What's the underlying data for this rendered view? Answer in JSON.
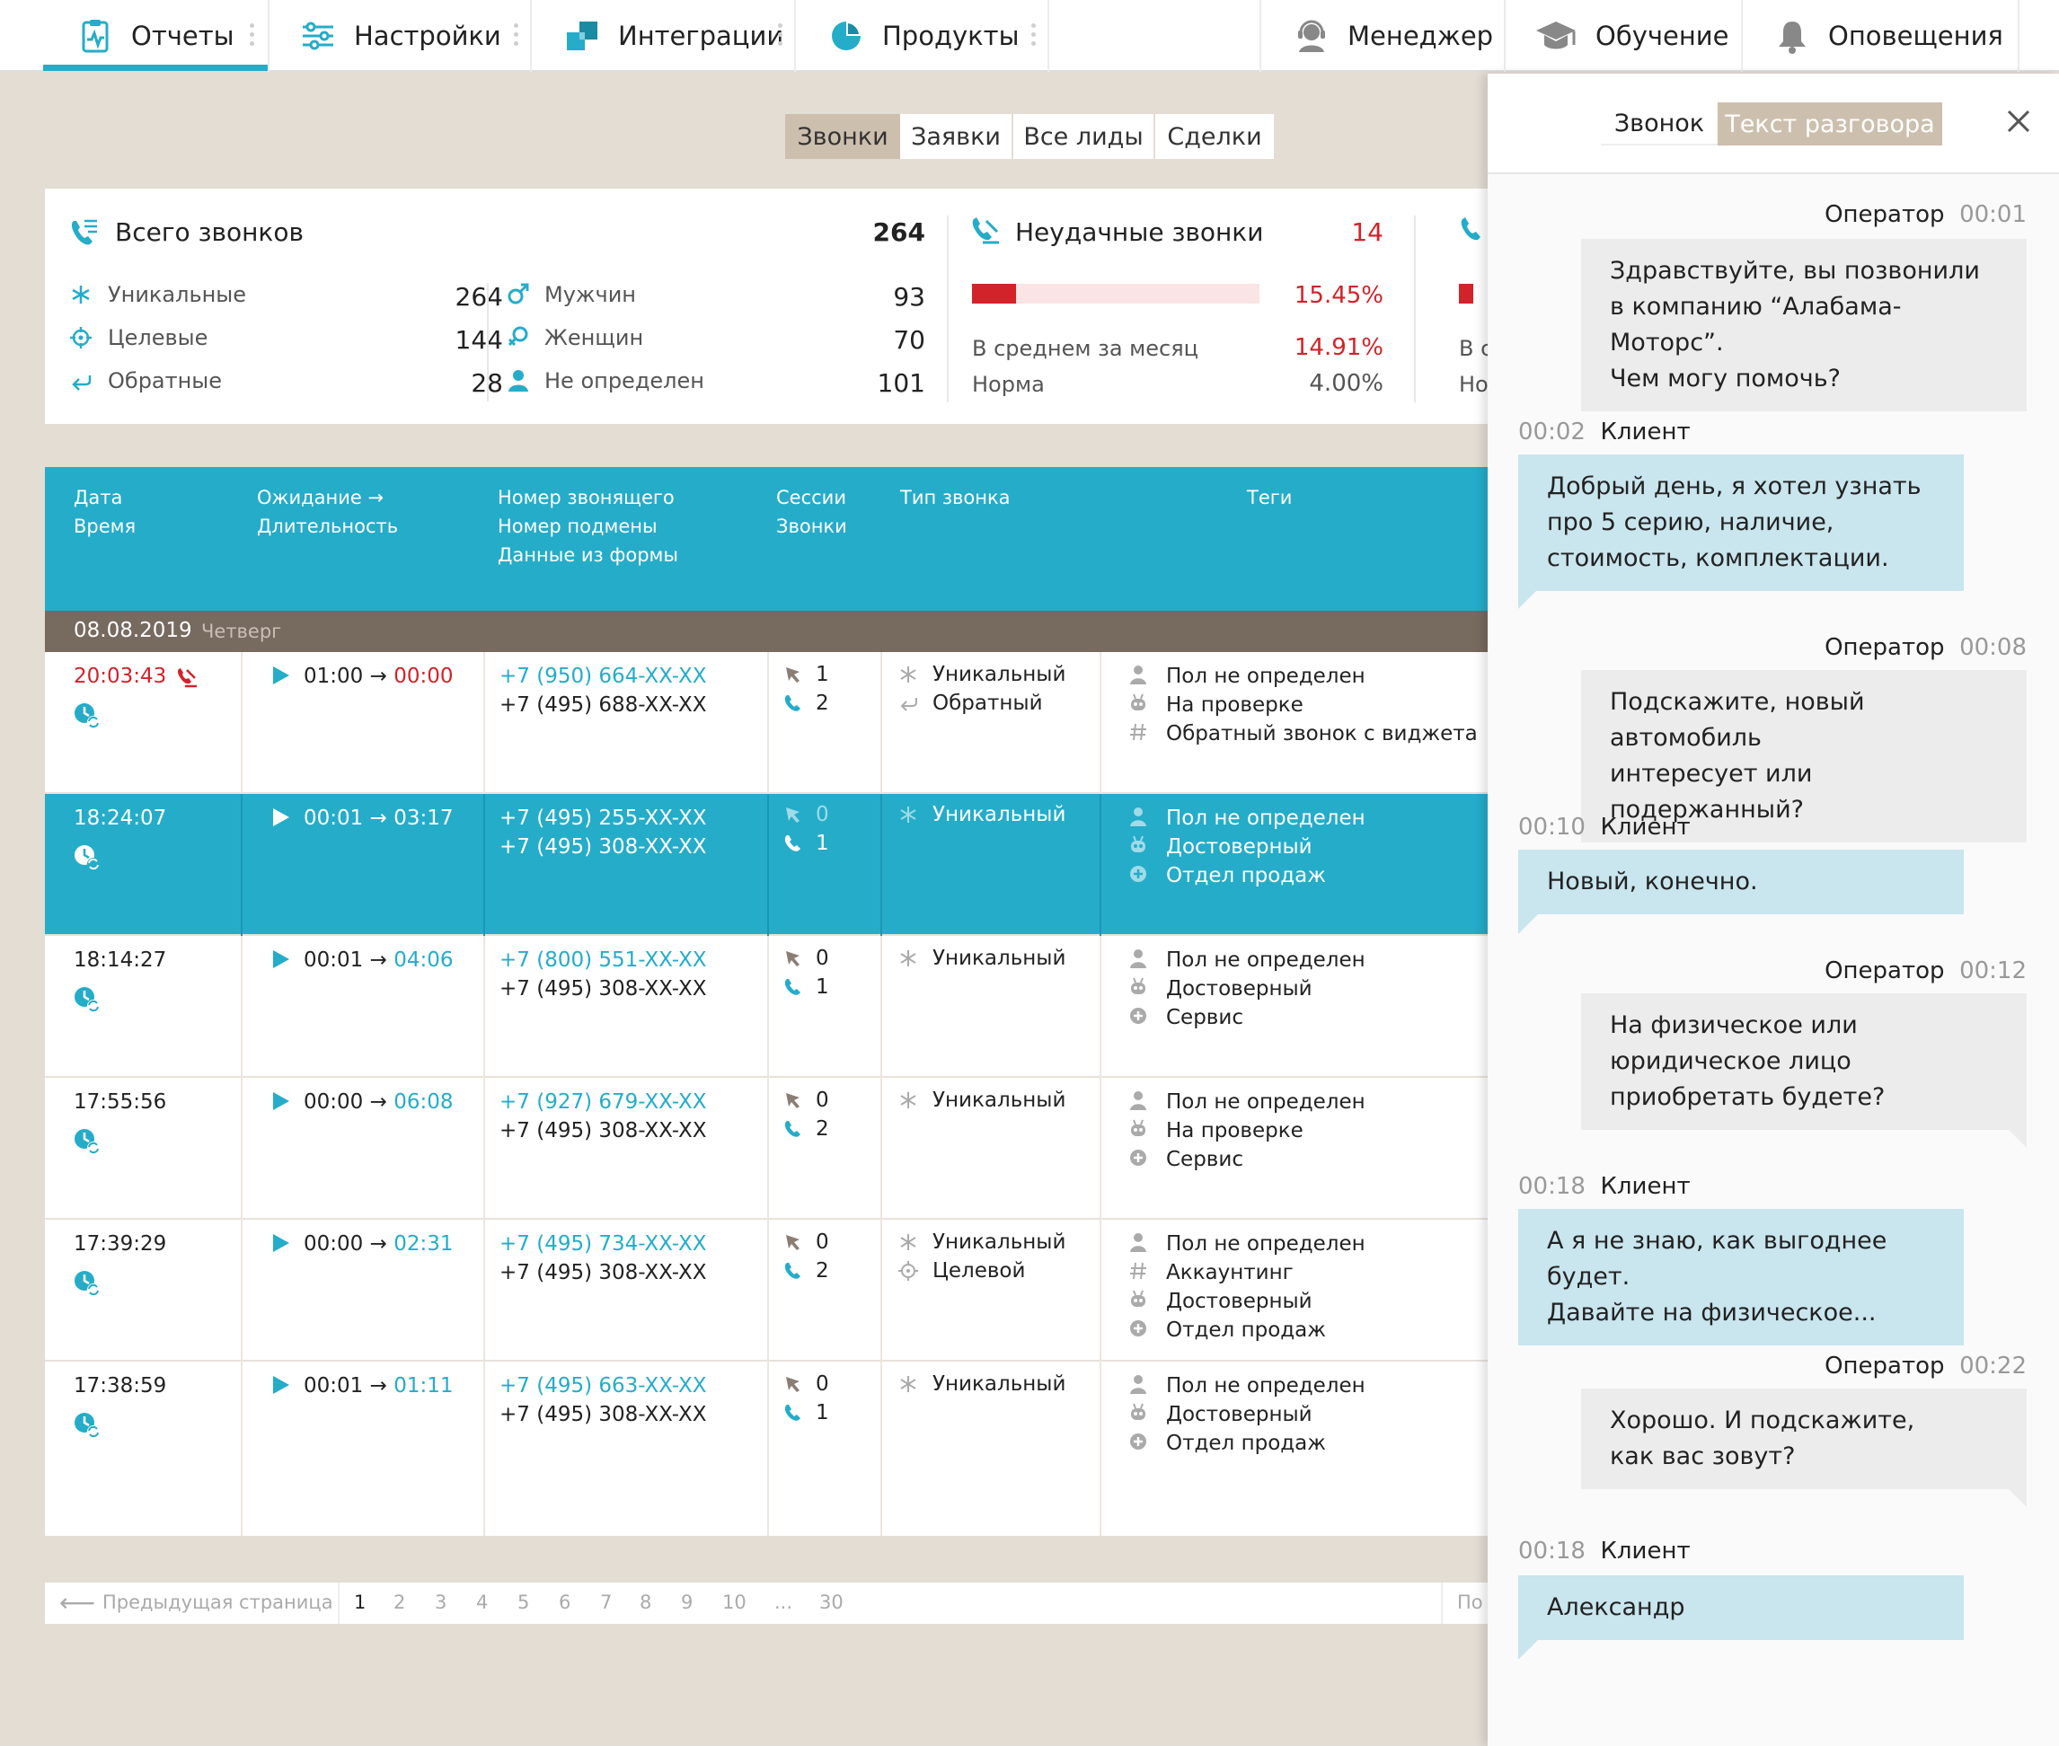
{
  "nav": {
    "items": [
      {
        "label": "Отчеты",
        "icon": "reports-icon"
      },
      {
        "label": "Настройки",
        "icon": "settings-sliders-icon"
      },
      {
        "label": "Интеграции",
        "icon": "integrations-icon"
      },
      {
        "label": "Продукты",
        "icon": "products-icon"
      }
    ],
    "right": [
      {
        "label": "Менеджер",
        "icon": "manager-headset-icon"
      },
      {
        "label": "Обучение",
        "icon": "graduation-cap-icon"
      },
      {
        "label": "Оповещения",
        "icon": "bell-icon"
      }
    ],
    "accent": "#25acc9"
  },
  "segments": [
    "Звонки",
    "Заявки",
    "Все лиды",
    "Сделки"
  ],
  "stats": {
    "total_label": "Всего звонков",
    "total_value": "264",
    "unique_label": "Уникальные",
    "unique_value": "264",
    "target_label": "Целевые",
    "target_value": "144",
    "callback_label": "Обратные",
    "callback_value": "28",
    "male_label": "Мужчин",
    "male_value": "93",
    "female_label": "Женщин",
    "female_value": "70",
    "undefined_label": "Не определен",
    "undefined_value": "101",
    "failed_label": "Неудачные звонки",
    "failed_value": "14",
    "failed_percent": "15.45%",
    "failed_fraction": 0.1545,
    "avg_label": "В среднем за месяц",
    "avg_value": "14.91%",
    "norm_label": "Норма",
    "norm_value": "4.00%",
    "cut_avg": "В с",
    "cut_norm": "Но",
    "red": "#d2232a"
  },
  "table": {
    "headers": {
      "date": "Дата",
      "time": "Время",
      "wait": "Ожидание →",
      "duration": "Длительность",
      "caller": "Номер звонящего",
      "substitute": "Номер подмены",
      "form": "Данные из формы",
      "sessions": "Сессии",
      "calls": "Звонки",
      "type": "Тип звонка",
      "tags": "Теги"
    },
    "group_date": "08.08.2019",
    "group_day": "Четверг",
    "rows": [
      {
        "time": "20:03:43",
        "wait": "01:00",
        "duration": "00:00",
        "phone1": "+7 (950) 664-XX-XX",
        "phone2": "+7 (495) 688-XX-XX",
        "sessions": "1",
        "calls": "2",
        "type1": "Уникальный",
        "type2": "Обратный",
        "tag1": "Пол не определен",
        "tag2": "На проверке",
        "tag3": "Обратный звонок с виджета"
      },
      {
        "time": "18:24:07",
        "wait": "00:01",
        "duration": "03:17",
        "phone1": "+7 (495) 255-XX-XX",
        "phone2": "+7 (495) 308-XX-XX",
        "sessions": "0",
        "calls": "1",
        "type1": "Уникальный",
        "type2": "",
        "tag1": "Пол не определен",
        "tag2": "Достоверный",
        "tag3": "Отдел продаж"
      },
      {
        "time": "18:14:27",
        "wait": "00:01",
        "duration": "04:06",
        "phone1": "+7 (800) 551-XX-XX",
        "phone2": "+7 (495) 308-XX-XX",
        "sessions": "0",
        "calls": "1",
        "type1": "Уникальный",
        "type2": "",
        "tag1": "Пол не определен",
        "tag2": "Достоверный",
        "tag3": "Сервис"
      },
      {
        "time": "17:55:56",
        "wait": "00:00",
        "duration": "06:08",
        "phone1": "+7 (927) 679-XX-XX",
        "phone2": "+7 (495) 308-XX-XX",
        "sessions": "0",
        "calls": "2",
        "type1": "Уникальный",
        "type2": "",
        "tag1": "Пол не определен",
        "tag2": "На проверке",
        "tag3": "Сервис"
      },
      {
        "time": "17:39:29",
        "wait": "00:00",
        "duration": "02:31",
        "phone1": "+7 (495) 734-XX-XX",
        "phone2": "+7 (495) 308-XX-XX",
        "sessions": "0",
        "calls": "2",
        "type1": "Уникальный",
        "type2": "Целевой",
        "tag1": "Пол не определен",
        "tag2": "Аккаунтинг",
        "tag3": "Достоверный",
        "tag4": "Отдел продаж"
      },
      {
        "time": "17:38:59",
        "wait": "00:01",
        "duration": "01:11",
        "phone1": "+7 (495) 663-XX-XX",
        "phone2": "+7 (495) 308-XX-XX",
        "sessions": "0",
        "calls": "1",
        "type1": "Уникальный",
        "type2": "",
        "tag1": "Пол не определен",
        "tag2": "Достоверный",
        "tag3": "Отдел продаж"
      }
    ]
  },
  "pager": {
    "prev": "Предыдущая страница",
    "pages": [
      "1",
      "2",
      "3",
      "4",
      "5",
      "6",
      "7",
      "8",
      "9",
      "10",
      "...",
      "30"
    ],
    "next_cut": "По"
  },
  "panel": {
    "tab_call": "Звонок",
    "tab_transcript": "Текст разговора",
    "messages": [
      {
        "who": "Оператор",
        "time": "00:01",
        "text": [
          "Здравствуйте, вы позвонили",
          "в компанию “Алабама-Моторс”.",
          "Чем могу помочь?"
        ]
      },
      {
        "who": "Клиент",
        "time": "00:02",
        "text": [
          "Добрый день, я хотел узнать",
          "про 5 серию, наличие,",
          "стоимость, комплектации."
        ]
      },
      {
        "who": "Оператор",
        "time": "00:08",
        "text": [
          "Подскажите, новый автомобиль",
          "интересует или подержанный?"
        ]
      },
      {
        "who": "Клиент",
        "time": "00:10",
        "text": [
          "Новый, конечно."
        ]
      },
      {
        "who": "Оператор",
        "time": "00:12",
        "text": [
          "На физическое или",
          "юридическое лицо",
          "приобретать будете?"
        ]
      },
      {
        "who": "Клиент",
        "time": "00:18",
        "text": [
          "А я не знаю, как выгоднее будет.",
          "Давайте на физическое..."
        ]
      },
      {
        "who": "Оператор",
        "time": "00:22",
        "text": [
          "Хорошо. И подскажите,",
          "как вас зовут?"
        ]
      },
      {
        "who": "Клиент",
        "time": "00:18",
        "text": [
          "Александр"
        ]
      }
    ]
  }
}
